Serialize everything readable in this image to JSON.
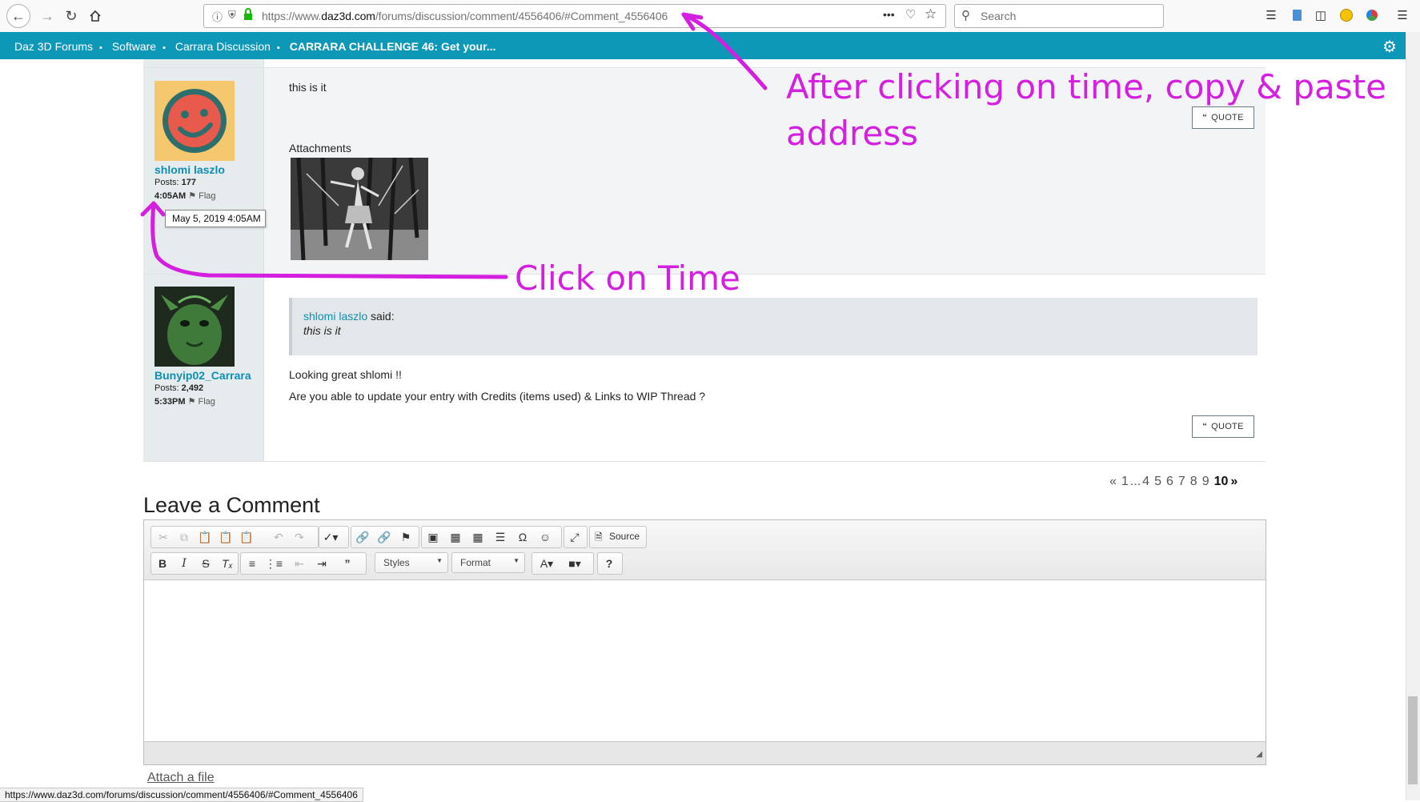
{
  "browser": {
    "url_prefix": "https://www.",
    "url_domain": "daz3d.com",
    "url_path": "/forums/discussion/comment/4556406/#Comment_4556406",
    "search_placeholder": "Search",
    "status_url": "https://www.daz3d.com/forums/discussion/comment/4556406/#Comment_4556406"
  },
  "breadcrumbs": [
    "Daz 3D Forums",
    "Software",
    "Carrara Discussion",
    "CARRARA CHALLENGE 46: Get your..."
  ],
  "posts": [
    {
      "author": "shlomi laszlo",
      "posts_label": "Posts:",
      "posts_count": "177",
      "time": "4:05AM",
      "flag": "Flag",
      "tooltip": "May  5, 2019  4:05AM",
      "body": "this is it",
      "attachments_label": "Attachments",
      "quote_label": "QUOTE"
    },
    {
      "author": "Bunyip02_Carrara",
      "posts_label": "Posts:",
      "posts_count": "2,492",
      "time": "5:33PM",
      "flag": "Flag",
      "quoted_author": "shlomi laszlo",
      "quoted_said": "said:",
      "quoted_text": "this is it",
      "line1": "Looking great shlomi !!",
      "line2": "Are you able to update your entry with Credits (items used) & Links to WIP Thread ?",
      "quote_label": "QUOTE"
    }
  ],
  "pagination": [
    "«",
    "1",
    "...",
    "4",
    "5",
    "6",
    "7",
    "8",
    "9",
    "10",
    "»"
  ],
  "comment": {
    "title": "Leave a Comment",
    "source_label": "Source",
    "styles_label": "Styles",
    "format_label": "Format",
    "attach_label": "Attach a file"
  },
  "annotations": {
    "top_line1": "After clicking on time, copy & paste",
    "top_line2": "address",
    "click": "Click on Time",
    "color": "#d41ee0"
  }
}
